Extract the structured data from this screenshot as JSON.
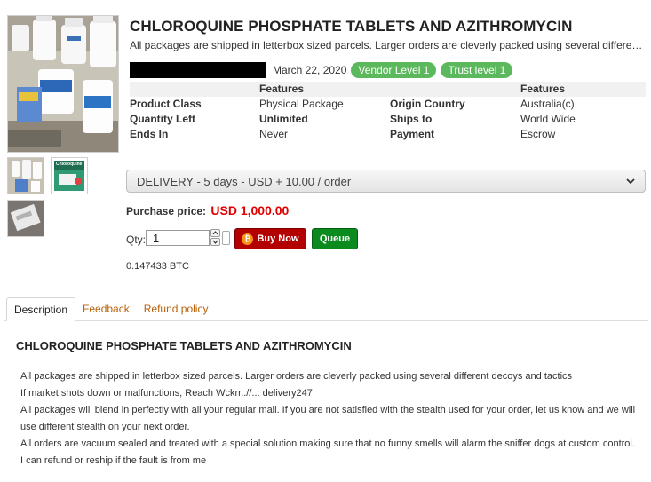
{
  "product": {
    "title": "CHLOROQUINE PHOSPHATE TABLETS AND AZITHROMYCIN",
    "subtitle": "All packages are shipped in letterbox sized parcels. Larger orders are cleverly packed using several different decoys and tactics",
    "date": "March 22, 2020",
    "badges": {
      "vendor": "Vendor Level 1",
      "trust": "Trust level 1"
    }
  },
  "images": {
    "thumb_text": "Chloroquine"
  },
  "features": {
    "header_left": "Features",
    "header_right": "Features",
    "rows": [
      {
        "label_left": "Product Class",
        "value_left": "Physical Package",
        "label_right": "Origin Country",
        "value_right": "Australia(c)"
      },
      {
        "label_left": "Quantity Left",
        "value_left": "Unlimited",
        "label_right": "Ships to",
        "value_right": "World Wide"
      },
      {
        "label_left": "Ends In",
        "value_left": "Never",
        "label_right": "Payment",
        "value_right": "Escrow"
      }
    ]
  },
  "delivery": {
    "selected": "DELIVERY - 5 days - USD + 10.00 / order"
  },
  "purchase": {
    "label": "Purchase price:",
    "price": "USD 1,000.00",
    "qty_label": "Qty:",
    "qty_value": "1",
    "buy_label": "Buy Now",
    "queue_label": "Queue",
    "btc": "0.147433 BTC"
  },
  "tabs": [
    "Description",
    "Feedback",
    "Refund policy"
  ],
  "description": {
    "title": "CHLOROQUINE PHOSPHATE TABLETS AND AZITHROMYCIN",
    "lines": [
      "All packages are shipped in letterbox sized parcels. Larger orders are cleverly packed using several different decoys and tactics",
      "If market shots down or malfunctions, Reach Wckrr..//..:  delivery247",
      "All packages will blend in perfectly with all your regular mail. If you are not satisfied with the stealth used for your order, let us know and we will use different stealth on your next order.",
      "All orders are vacuum sealed and treated with a special solution making sure that no funny smells will alarm the sniffer dogs at custom control.",
      "I can refund or reship if the fault is from me"
    ]
  },
  "colors": {
    "badge": "#5cb85c",
    "price": "#e00000",
    "buy": "#b30000",
    "queue": "#0b8a1e",
    "tab_link": "#b8620a"
  }
}
